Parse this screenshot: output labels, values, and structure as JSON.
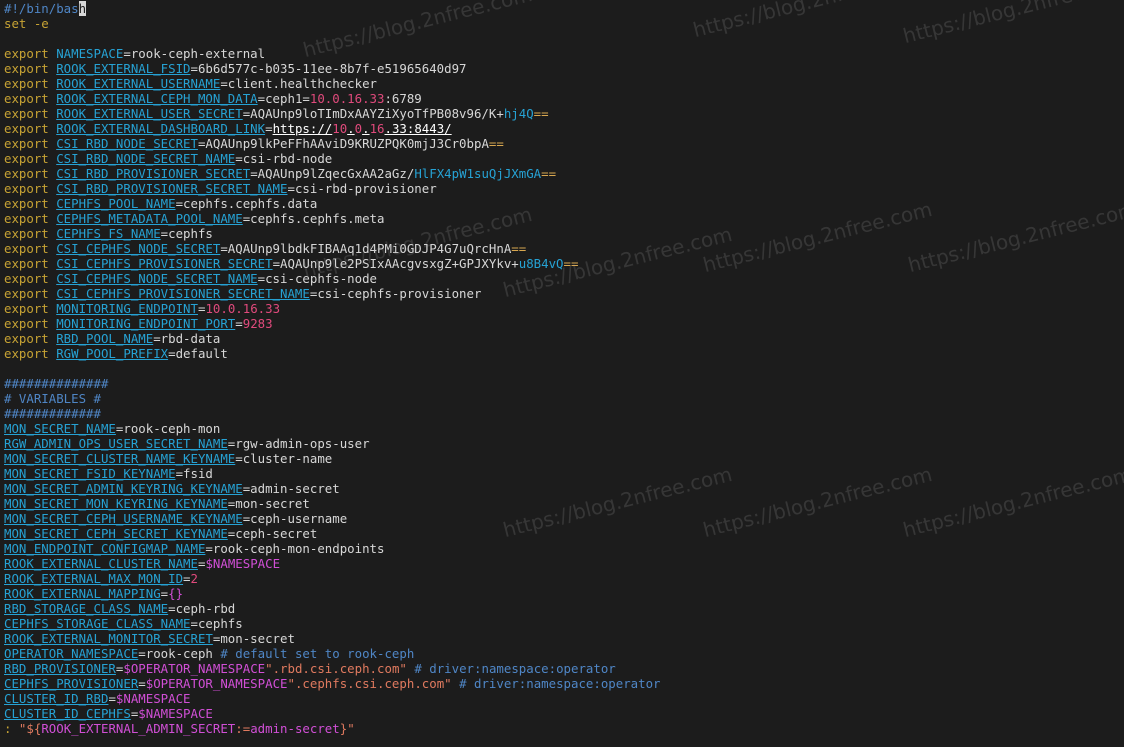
{
  "editor": {
    "lines": [
      [
        {
          "t": "#!/bin/bas",
          "c": "cmt"
        },
        {
          "t": "h",
          "c": "cur"
        }
      ],
      [
        {
          "t": "set -e",
          "c": "kw"
        }
      ],
      [],
      [
        {
          "t": "export ",
          "c": "kw"
        },
        {
          "t": "NAMESPACE",
          "c": "var2"
        },
        {
          "t": "=rook-ceph-external",
          "c": "val"
        }
      ],
      [
        {
          "t": "export ",
          "c": "kw"
        },
        {
          "t": "ROOK_EXTERNAL_FSID",
          "c": "var"
        },
        {
          "t": "=6b6d577c-b035-11ee-8b7f-e51965640d97",
          "c": "val"
        }
      ],
      [
        {
          "t": "export ",
          "c": "kw"
        },
        {
          "t": "ROOK_EXTERNAL_USERNAME",
          "c": "var"
        },
        {
          "t": "=client.healthchecker",
          "c": "val"
        }
      ],
      [
        {
          "t": "export ",
          "c": "kw"
        },
        {
          "t": "ROOK_EXTERNAL_CEPH_MON_DATA",
          "c": "var"
        },
        {
          "t": "=ceph1=",
          "c": "val"
        },
        {
          "t": "10.0.16.33",
          "c": "num"
        },
        {
          "t": ":6789",
          "c": "val"
        }
      ],
      [
        {
          "t": "export ",
          "c": "kw"
        },
        {
          "t": "ROOK_EXTERNAL_USER_SECRET",
          "c": "var"
        },
        {
          "t": "=AQAUnp9loTImDxAAYZiXyoTfPB08v96/K+",
          "c": "val"
        },
        {
          "t": "hj4Q",
          "c": "var2"
        },
        {
          "t": "==",
          "c": "eq"
        }
      ],
      [
        {
          "t": "export ",
          "c": "kw"
        },
        {
          "t": "ROOK_EXTERNAL_DASHBOARD_LINK",
          "c": "var"
        },
        {
          "t": "=",
          "c": "val"
        },
        {
          "t": "https://",
          "c": "url"
        },
        {
          "t": "10",
          "c": "num"
        },
        {
          "t": ".",
          "c": "url"
        },
        {
          "t": "0",
          "c": "num"
        },
        {
          "t": ".",
          "c": "url"
        },
        {
          "t": "16",
          "c": "num"
        },
        {
          "t": ".33:8443/",
          "c": "url"
        }
      ],
      [
        {
          "t": "export ",
          "c": "kw"
        },
        {
          "t": "CSI_RBD_NODE_SECRET",
          "c": "var"
        },
        {
          "t": "=AQAUnp9lkPeFFhAAviD9KRUZPQK0mjJ3Cr0bpA",
          "c": "val"
        },
        {
          "t": "==",
          "c": "eq"
        }
      ],
      [
        {
          "t": "export ",
          "c": "kw"
        },
        {
          "t": "CSI_RBD_NODE_SECRET_NAME",
          "c": "var"
        },
        {
          "t": "=csi-rbd-node",
          "c": "val"
        }
      ],
      [
        {
          "t": "export ",
          "c": "kw"
        },
        {
          "t": "CSI_RBD_PROVISIONER_SECRET",
          "c": "var"
        },
        {
          "t": "=AQAUnp9lZqecGxAA2aGz/",
          "c": "val"
        },
        {
          "t": "HlFX4pW1suQjJXmGA",
          "c": "var2"
        },
        {
          "t": "==",
          "c": "eq"
        }
      ],
      [
        {
          "t": "export ",
          "c": "kw"
        },
        {
          "t": "CSI_RBD_PROVISIONER_SECRET_NAME",
          "c": "var"
        },
        {
          "t": "=csi-rbd-provisioner",
          "c": "val"
        }
      ],
      [
        {
          "t": "export ",
          "c": "kw"
        },
        {
          "t": "CEPHFS_POOL_NAME",
          "c": "var"
        },
        {
          "t": "=cephfs.cephfs.data",
          "c": "val"
        }
      ],
      [
        {
          "t": "export ",
          "c": "kw"
        },
        {
          "t": "CEPHFS_METADATA_POOL_NAME",
          "c": "var"
        },
        {
          "t": "=cephfs.cephfs.meta",
          "c": "val"
        }
      ],
      [
        {
          "t": "export ",
          "c": "kw"
        },
        {
          "t": "CEPHFS_FS_NAME",
          "c": "var"
        },
        {
          "t": "=cephfs",
          "c": "val"
        }
      ],
      [
        {
          "t": "export ",
          "c": "kw"
        },
        {
          "t": "CSI_CEPHFS_NODE_SECRET",
          "c": "var"
        },
        {
          "t": "=AQAUnp9lbdkFIBAAq1d4PMi0GDJP4G7uQrcHnA",
          "c": "val"
        },
        {
          "t": "==",
          "c": "eq"
        }
      ],
      [
        {
          "t": "export ",
          "c": "kw"
        },
        {
          "t": "CSI_CEPHFS_PROVISIONER_SECRET",
          "c": "var"
        },
        {
          "t": "=AQAUnp9le2PSIxAAcgvsxgZ+GPJXYkv+",
          "c": "val"
        },
        {
          "t": "u8B4vQ",
          "c": "var2"
        },
        {
          "t": "==",
          "c": "eq"
        }
      ],
      [
        {
          "t": "export ",
          "c": "kw"
        },
        {
          "t": "CSI_CEPHFS_NODE_SECRET_NAME",
          "c": "var"
        },
        {
          "t": "=csi-cephfs-node",
          "c": "val"
        }
      ],
      [
        {
          "t": "export ",
          "c": "kw"
        },
        {
          "t": "CSI_CEPHFS_PROVISIONER_SECRET_NAME",
          "c": "var"
        },
        {
          "t": "=csi-cephfs-provisioner",
          "c": "val"
        }
      ],
      [
        {
          "t": "export ",
          "c": "kw"
        },
        {
          "t": "MONITORING_ENDPOINT",
          "c": "var"
        },
        {
          "t": "=",
          "c": "val"
        },
        {
          "t": "10.0.16.33",
          "c": "num"
        }
      ],
      [
        {
          "t": "export ",
          "c": "kw"
        },
        {
          "t": "MONITORING_ENDPOINT_PORT",
          "c": "var"
        },
        {
          "t": "=",
          "c": "val"
        },
        {
          "t": "9283",
          "c": "num"
        }
      ],
      [
        {
          "t": "export ",
          "c": "kw"
        },
        {
          "t": "RBD_POOL_NAME",
          "c": "var"
        },
        {
          "t": "=rbd-data",
          "c": "val"
        }
      ],
      [
        {
          "t": "export ",
          "c": "kw"
        },
        {
          "t": "RGW_POOL_PREFIX",
          "c": "var"
        },
        {
          "t": "=default",
          "c": "val"
        }
      ],
      [],
      [
        {
          "t": "##############",
          "c": "cmt"
        }
      ],
      [
        {
          "t": "# VARIABLES #",
          "c": "cmt"
        }
      ],
      [
        {
          "t": "#############",
          "c": "cmt"
        }
      ],
      [
        {
          "t": "MON_SECRET_NAME",
          "c": "var"
        },
        {
          "t": "=rook-ceph-mon",
          "c": "val"
        }
      ],
      [
        {
          "t": "RGW_ADMIN_OPS_USER_SECRET_NAME",
          "c": "var"
        },
        {
          "t": "=rgw-admin-ops-user",
          "c": "val"
        }
      ],
      [
        {
          "t": "MON_SECRET_CLUSTER_NAME_KEYNAME",
          "c": "var"
        },
        {
          "t": "=cluster-name",
          "c": "val"
        }
      ],
      [
        {
          "t": "MON_SECRET_FSID_KEYNAME",
          "c": "var"
        },
        {
          "t": "=fsid",
          "c": "val"
        }
      ],
      [
        {
          "t": "MON_SECRET_ADMIN_KEYRING_KEYNAME",
          "c": "var"
        },
        {
          "t": "=admin-secret",
          "c": "val"
        }
      ],
      [
        {
          "t": "MON_SECRET_MON_KEYRING_KEYNAME",
          "c": "var"
        },
        {
          "t": "=mon-secret",
          "c": "val"
        }
      ],
      [
        {
          "t": "MON_SECRET_CEPH_USERNAME_KEYNAME",
          "c": "var"
        },
        {
          "t": "=ceph-username",
          "c": "val"
        }
      ],
      [
        {
          "t": "MON_SECRET_CEPH_SECRET_KEYNAME",
          "c": "var"
        },
        {
          "t": "=ceph-secret",
          "c": "val"
        }
      ],
      [
        {
          "t": "MON_ENDPOINT_CONFIGMAP_NAME",
          "c": "var"
        },
        {
          "t": "=rook-ceph-mon-endpoints",
          "c": "val"
        }
      ],
      [
        {
          "t": "ROOK_EXTERNAL_CLUSTER_NAME",
          "c": "var"
        },
        {
          "t": "=",
          "c": "val"
        },
        {
          "t": "$NAMESPACE",
          "c": "ref"
        }
      ],
      [
        {
          "t": "ROOK_EXTERNAL_MAX_MON_ID",
          "c": "var"
        },
        {
          "t": "=",
          "c": "val"
        },
        {
          "t": "2",
          "c": "num"
        }
      ],
      [
        {
          "t": "ROOK_EXTERNAL_MAPPING",
          "c": "var"
        },
        {
          "t": "=",
          "c": "val"
        },
        {
          "t": "{}",
          "c": "ref"
        }
      ],
      [
        {
          "t": "RBD_STORAGE_CLASS_NAME",
          "c": "var"
        },
        {
          "t": "=ceph-rbd",
          "c": "val"
        }
      ],
      [
        {
          "t": "CEPHFS_STORAGE_CLASS_NAME",
          "c": "var"
        },
        {
          "t": "=cephfs",
          "c": "val"
        }
      ],
      [
        {
          "t": "ROOK_EXTERNAL_MONITOR_SECRET",
          "c": "var"
        },
        {
          "t": "=mon-secret",
          "c": "val"
        }
      ],
      [
        {
          "t": "OPERATOR_NAMESPACE",
          "c": "var"
        },
        {
          "t": "=rook-ceph ",
          "c": "val"
        },
        {
          "t": "# default set to rook-ceph",
          "c": "cmt"
        }
      ],
      [
        {
          "t": "RBD_PROVISIONER",
          "c": "var"
        },
        {
          "t": "=",
          "c": "val"
        },
        {
          "t": "$OPERATOR_NAMESPACE",
          "c": "ref"
        },
        {
          "t": "\".rbd.csi.ceph.com\"",
          "c": "str"
        },
        {
          "t": " ",
          "c": "val"
        },
        {
          "t": "# driver:namespace:operator",
          "c": "cmt"
        }
      ],
      [
        {
          "t": "CEPHFS_PROVISIONER",
          "c": "var"
        },
        {
          "t": "=",
          "c": "val"
        },
        {
          "t": "$OPERATOR_NAMESPACE",
          "c": "ref"
        },
        {
          "t": "\".cephfs.csi.ceph.com\"",
          "c": "str"
        },
        {
          "t": " ",
          "c": "val"
        },
        {
          "t": "# driver:namespace:operator",
          "c": "cmt"
        }
      ],
      [
        {
          "t": "CLUSTER_ID_RBD",
          "c": "var"
        },
        {
          "t": "=",
          "c": "val"
        },
        {
          "t": "$NAMESPACE",
          "c": "ref"
        }
      ],
      [
        {
          "t": "CLUSTER_ID_CEPHFS",
          "c": "var"
        },
        {
          "t": "=",
          "c": "val"
        },
        {
          "t": "$NAMESPACE",
          "c": "ref"
        }
      ],
      [
        {
          "t": ": ",
          "c": "kw"
        },
        {
          "t": "\"${",
          "c": "str"
        },
        {
          "t": "ROOK_EXTERNAL_ADMIN_SECRET",
          "c": "ref"
        },
        {
          "t": ":=",
          "c": "str"
        },
        {
          "t": "admin-secret",
          "c": "ref"
        },
        {
          "t": "}\"",
          "c": "str"
        }
      ]
    ]
  },
  "watermark": {
    "text": "https://blog.2nfree.com"
  }
}
